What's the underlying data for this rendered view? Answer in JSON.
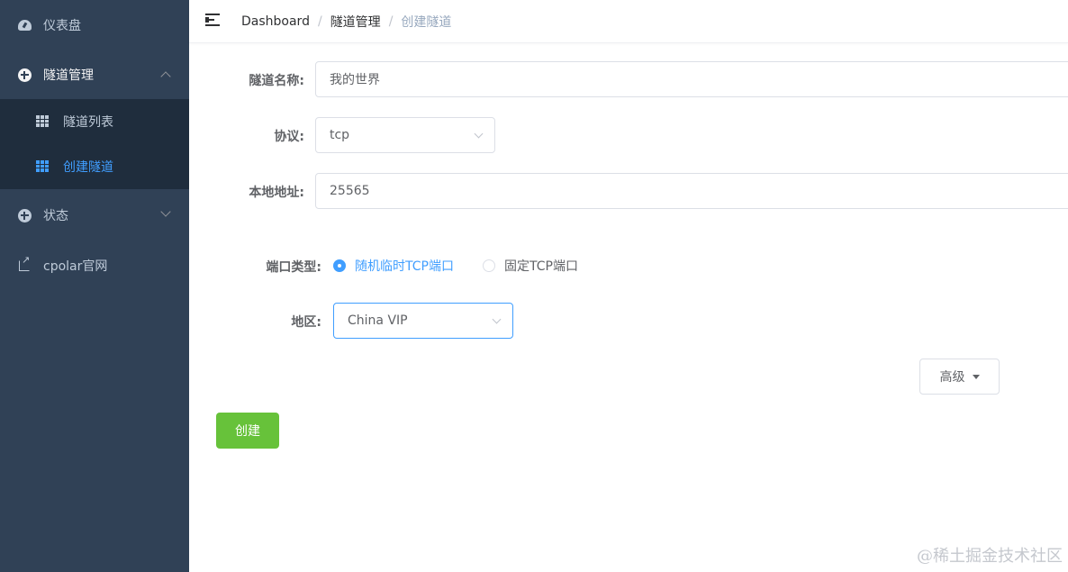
{
  "sidebar": {
    "items": [
      {
        "label": "仪表盘",
        "icon": "dashboard-icon"
      },
      {
        "label": "隧道管理",
        "icon": "circle-plus-icon",
        "expanded": true
      },
      {
        "label": "状态",
        "icon": "circle-plus-icon",
        "expanded": false
      },
      {
        "label": "cpolar官网",
        "icon": "external-link-icon"
      }
    ],
    "submenu": [
      {
        "label": "隧道列表",
        "icon": "grid-icon"
      },
      {
        "label": "创建隧道",
        "icon": "grid-icon",
        "active": true
      }
    ],
    "colors": {
      "background": "#304156",
      "submenu_bg": "#1f2d3d",
      "active": "#409eff"
    }
  },
  "header": {
    "breadcrumb": [
      "Dashboard",
      "隧道管理",
      "创建隧道"
    ],
    "separator": "/"
  },
  "form": {
    "name": {
      "label": "隧道名称:",
      "value": "我的世界"
    },
    "protocol": {
      "label": "协议:",
      "value": "tcp"
    },
    "local_address": {
      "label": "本地地址:",
      "value": "25565"
    },
    "port_type": {
      "label": "端口类型:",
      "options": [
        "随机临时TCP端口",
        "固定TCP端口"
      ],
      "selected": "随机临时TCP端口"
    },
    "region": {
      "label": "地区:",
      "value": "China VIP"
    },
    "advanced_label": "高级",
    "create_label": "创建",
    "colors": {
      "primary": "#409eff",
      "success": "#67c23a"
    }
  },
  "watermark": "@稀土掘金技术社区"
}
